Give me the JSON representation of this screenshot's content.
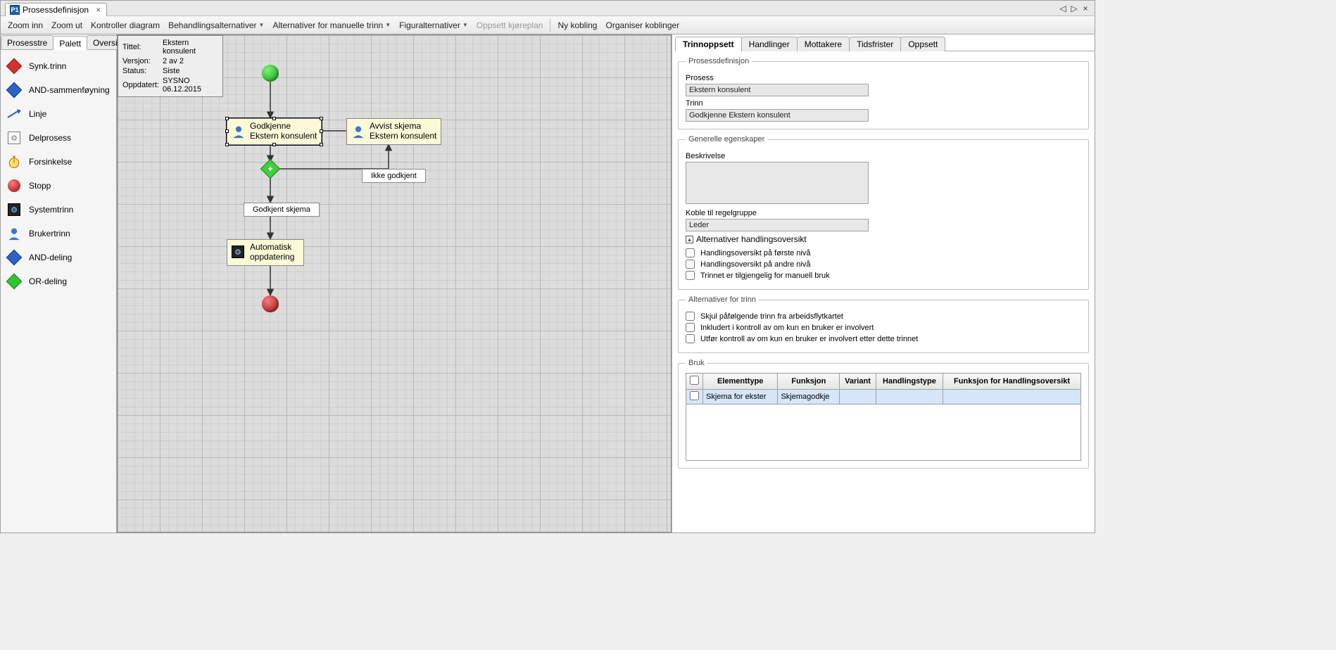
{
  "titleTab": {
    "label": "Prosessdefinisjon"
  },
  "toolbar": {
    "zoomIn": "Zoom inn",
    "zoomOut": "Zoom ut",
    "controlDiagram": "Kontroller diagram",
    "treatmentAlternatives": "Behandlingsalternativer",
    "manualStepAlternatives": "Alternativer for manuelle trinn",
    "figureAlternatives": "Figuralternativer",
    "scheduleSetup": "Oppsett kjøreplan",
    "newCoupling": "Ny kobling",
    "organizeCouplings": "Organiser koblinger"
  },
  "leftTabs": {
    "process_tree": "Prosesstre",
    "palette": "Palett",
    "overview": "Oversikt"
  },
  "palette": {
    "sync": "Synk.trinn",
    "andJoin": "AND-sammenføyning",
    "line": "Linje",
    "subprocess": "Delprosess",
    "delay": "Forsinkelse",
    "stop": "Stopp",
    "systemStep": "Systemtrinn",
    "userStep": "Brukertrinn",
    "andSplit": "AND-deling",
    "orSplit": "OR-deling"
  },
  "infoBox": {
    "titleLabel": "Tittel:",
    "title": "Ekstern konsulent",
    "versionLabel": "Versjon:",
    "version": "2 av 2",
    "statusLabel": "Status:",
    "status": "Siste",
    "updatedLabel": "Oppdatert:",
    "updated": "SYSNO  06.12.2015"
  },
  "diagram": {
    "node1Line1": "Godkjenne",
    "node1Line2": "Ekstern konsulent",
    "node2Line1": "Avvist skjema",
    "node2Line2": "Ekstern konsulent",
    "notApproved": "Ikke godkjent",
    "approved": "Godkjent skjema",
    "node3Line1": "Automatisk",
    "node3Line2": "oppdatering"
  },
  "rightTabs": {
    "stepSetup": "Trinnoppsett",
    "actions": "Handlinger",
    "recipients": "Mottakere",
    "deadlines": "Tidsfrister",
    "setup": "Oppsett"
  },
  "groups": {
    "processDef": "Prosessdefinisjon",
    "processLabel": "Prosess",
    "processValue": "Ekstern konsulent",
    "stepLabel": "Trinn",
    "stepValue": "Godkjenne Ekstern konsulent",
    "general": "Generelle egenskaper",
    "descLabel": "Beskrivelse",
    "descValue": "",
    "ruleGroupLabel": "Koble til regelgruppe",
    "ruleGroupValue": "Leder",
    "altOverview": "Alternativer handlingsoversikt",
    "chk1": "Handlingsoversikt på første nivå",
    "chk2": "Handlingsoversikt på andre nivå",
    "chk3": "Trinnet er tilgjengelig for manuell bruk",
    "altStep": "Alternativer for trinn",
    "chk4": "Skjul påfølgende trinn fra arbeidsflytkartet",
    "chk5": "Inkludert i kontroll av om kun en bruker er involvert",
    "chk6": "Utfør kontroll av om kun en bruker er involvert etter dette trinnet",
    "use": "Bruk"
  },
  "gridHeaders": {
    "elementType": "Elementtype",
    "function": "Funksjon",
    "variant": "Variant",
    "actionType": "Handlingstype",
    "funcOverview": "Funksjon for Handlingsoversikt"
  },
  "gridRow": {
    "elementType": "Skjema for ekster",
    "function": "Skjemagodkje"
  }
}
